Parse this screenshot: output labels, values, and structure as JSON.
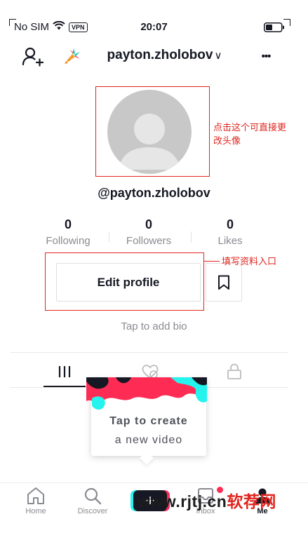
{
  "status_bar": {
    "carrier": "No SIM",
    "vpn": "VPN",
    "time": "20:07"
  },
  "header": {
    "username_title": "payton.zholobov",
    "chevron": "∨",
    "more": "•••"
  },
  "profile": {
    "handle": "@payton.zholobov",
    "stats": [
      {
        "value": "0",
        "label": "Following"
      },
      {
        "value": "0",
        "label": "Followers"
      },
      {
        "value": "0",
        "label": "Likes"
      }
    ],
    "edit_label": "Edit profile",
    "bio_prompt": "Tap to add bio"
  },
  "annotations": {
    "avatar_note_line1": "点击这个可直接更",
    "avatar_note_line2": "改头像",
    "edit_note": "填写资料入口",
    "color": "#e0261f"
  },
  "tooltip": {
    "line1": "Tap to create",
    "line2": "a new video"
  },
  "nav": {
    "items": [
      {
        "label": "Home",
        "icon": "home-icon"
      },
      {
        "label": "Discover",
        "icon": "search-icon"
      },
      {
        "label": "",
        "icon": "plus-icon"
      },
      {
        "label": "Inbox",
        "icon": "inbox-icon"
      },
      {
        "label": "Me",
        "icon": "person-icon"
      }
    ]
  },
  "watermark": {
    "text": "www.rjtj.cn",
    "accent": "软荐网"
  },
  "colors": {
    "accent_red": "#e0261f",
    "tiktok_cyan": "#25f4ee",
    "tiktok_pink": "#fe2c55",
    "text_primary": "#161823",
    "text_secondary": "#8a8b91"
  }
}
